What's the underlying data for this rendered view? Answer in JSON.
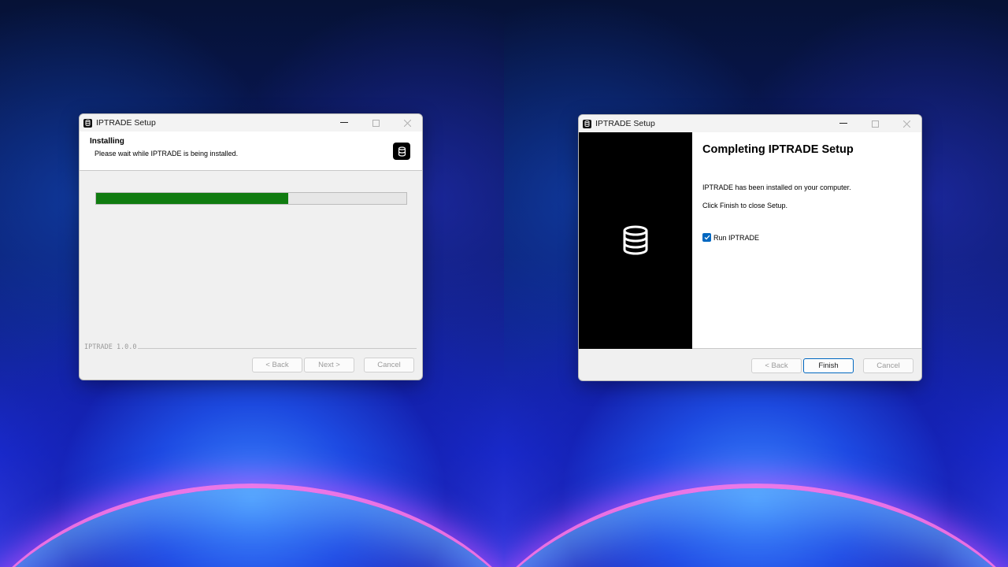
{
  "installer_left": {
    "title": "IPTRADE Setup",
    "header_title": "Installing",
    "header_subtitle": "Please wait while IPTRADE is being installed.",
    "progress_fraction": 0.62,
    "version_label": "IPTRADE 1.0.0",
    "buttons": {
      "back": "< Back",
      "next": "Next >",
      "cancel": "Cancel"
    }
  },
  "installer_right": {
    "title": "IPTRADE Setup",
    "heading": "Completing IPTRADE Setup",
    "line1": "IPTRADE has been installed on your computer.",
    "line2": "Click Finish to close Setup.",
    "checkbox_label": "Run IPTRADE",
    "checkbox_checked": true,
    "buttons": {
      "back": "< Back",
      "finish": "Finish",
      "cancel": "Cancel"
    }
  },
  "icons": {
    "app": "database-icon",
    "minimize": "minimize-icon",
    "maximize": "maximize-icon",
    "close": "close-icon",
    "checkbox": "checkmark-icon"
  },
  "colors": {
    "progress_fill": "#107c10",
    "accent": "#0067c0",
    "sidebar_bg": "#000000"
  }
}
